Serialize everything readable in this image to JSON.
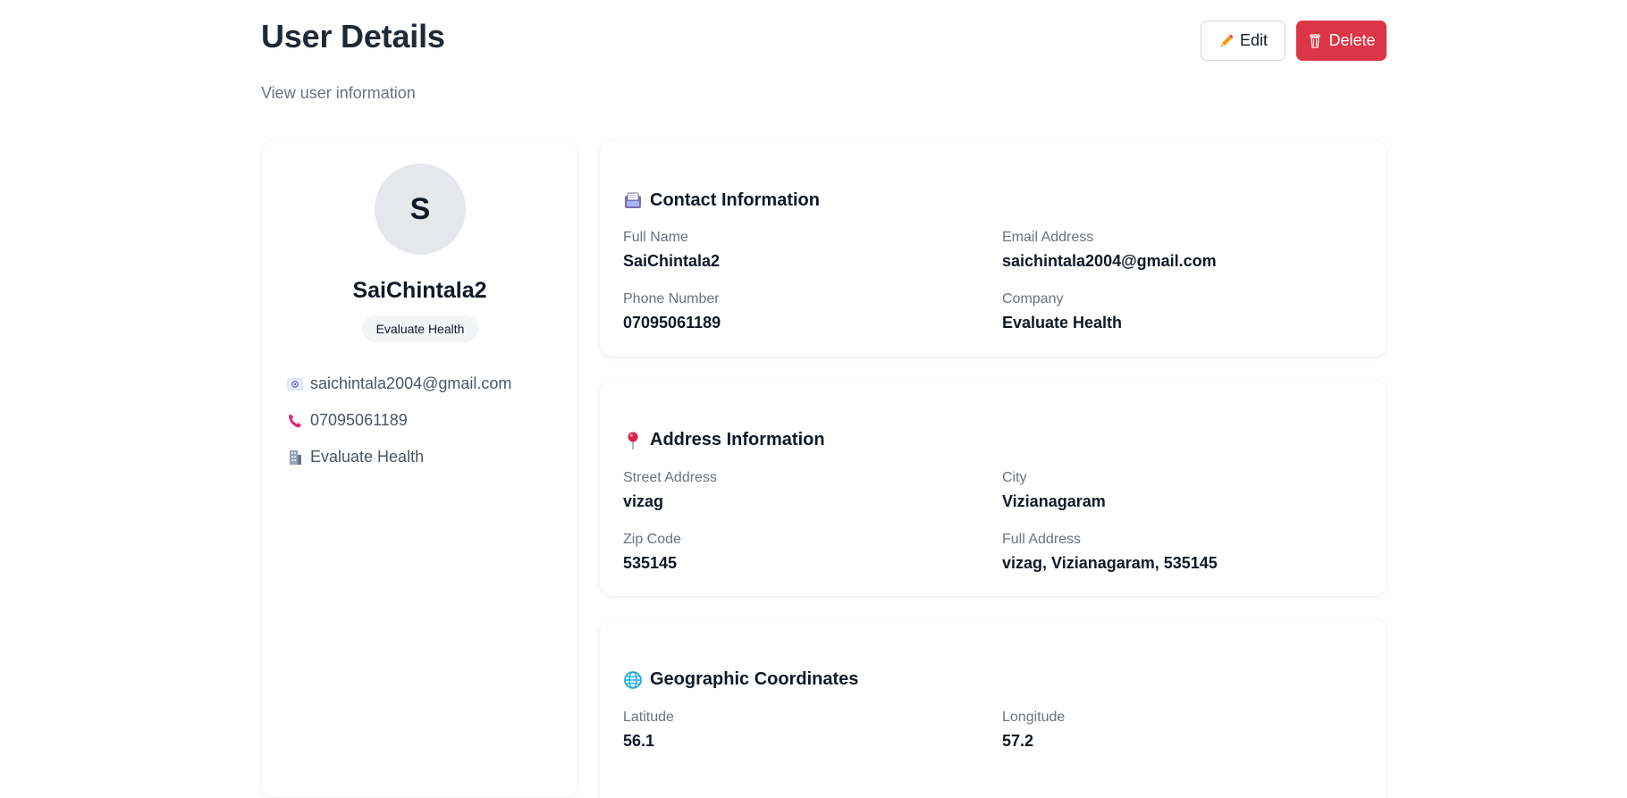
{
  "header": {
    "title": "User Details",
    "subtitle": "View user information",
    "edit_label": "Edit",
    "delete_label": "Delete"
  },
  "profile": {
    "avatar_initial": "S",
    "name": "SaiChintala2",
    "company_badge": "Evaluate Health",
    "email": "saichintala2004@gmail.com",
    "phone": "07095061189",
    "company": "Evaluate Health",
    "email_icon": "envelope-icon",
    "phone_icon": "phone-icon",
    "company_icon": "building-icon"
  },
  "contact": {
    "title": "Contact Information",
    "icon": "contact-card-icon",
    "full_name_label": "Full Name",
    "full_name": "SaiChintala2",
    "email_label": "Email Address",
    "email": "saichintala2004@gmail.com",
    "phone_label": "Phone Number",
    "phone": "07095061189",
    "company_label": "Company",
    "company": "Evaluate Health"
  },
  "address": {
    "title": "Address Information",
    "icon": "pin-icon",
    "street_label": "Street Address",
    "street": "vizag",
    "city_label": "City",
    "city": "Vizianagaram",
    "zip_label": "Zip Code",
    "zip": "535145",
    "full_label": "Full Address",
    "full": "vizag, Vizianagaram, 535145"
  },
  "geo": {
    "title": "Geographic Coordinates",
    "icon": "globe-icon",
    "lat_label": "Latitude",
    "lat": "56.1",
    "lng_label": "Longitude",
    "lng": "57.2"
  },
  "colors": {
    "delete_button": "#dc3545",
    "avatar_bg": "#e5e7eb",
    "muted_text": "#6b7280"
  }
}
